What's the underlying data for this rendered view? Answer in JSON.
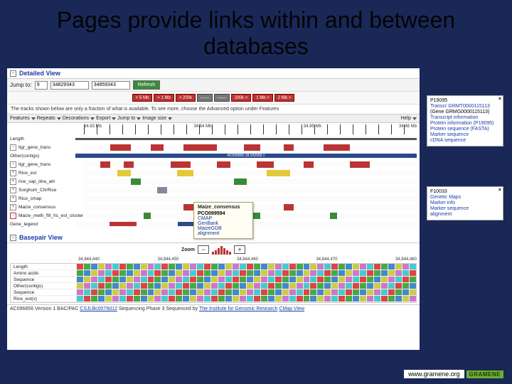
{
  "slide": {
    "title": "Pages provide links within and between databases"
  },
  "detailed": {
    "header": "Detailed View",
    "jump_label": "Jump to:",
    "chrom": "9",
    "from": "34829343",
    "to": "34859343",
    "refresh": "Refresh",
    "zoom": [
      "< 5 Mb",
      "< 1 Mb",
      "< 200k",
      "——",
      "——",
      "200k >",
      "1 Mb >",
      "2 Mb >"
    ],
    "note": "The tracks shown below are only a fraction of what is available. To see more, choose the Advanced option under Features",
    "menu": [
      "Features",
      "Repeats",
      "Decorations",
      "Export",
      "Jump to",
      "Image size"
    ],
    "help": "Help",
    "tracks": [
      "Length",
      "tigr_gene_trans",
      "Other(contigs)",
      "tigr_gene_trans",
      "Rice_est",
      "rice_sap_dna_aln",
      "Sorghum_ChrRice",
      "Rice_cmap",
      "Maize_consensus",
      "Maize_meth_filt_hc_est_cluster",
      "",
      "Gene_legend"
    ]
  },
  "popup": {
    "header": "Maize_consensus",
    "items": [
      "PCO099594",
      "CMAP",
      "GenBank",
      "MaizeGDB",
      "alignment"
    ]
  },
  "basepair": {
    "header": "Basepair View",
    "zoom_label": "Zoom",
    "ruler_ticks": [
      "34,844,440",
      "34,844,450",
      "34,844,460",
      "34,844,470",
      "34,844,480"
    ],
    "rows": [
      "Length",
      "Amino acids",
      "Sequence",
      "Other(contigs)",
      "Sequence",
      "Rice_est(s)"
    ]
  },
  "footer": {
    "text_a": "AC096856 Version 1  BAC/PAC ",
    "link_a": "CSJLBc0079d12",
    "text_b": "  Sequencing Phase 3  Sequenced by ",
    "link_b": "The Institute for Genomic Research",
    "link_c": "CMap View"
  },
  "side1": {
    "id": "P19095",
    "lines": [
      "Transcr GRMT0000115113",
      "(Gene GRMG0000115113)",
      "Transcript information",
      "Protein information (P19095)",
      "Protein sequence (FASTA)",
      "Marker sequence",
      "cDNA sequence"
    ]
  },
  "side2": {
    "id": "F10033",
    "lines": [
      "Genetic Maps",
      "Marker info",
      "Marker sequence",
      "alignment"
    ]
  },
  "url": {
    "text": "www.gramene.org",
    "logo": "GRAMENE"
  },
  "colors": {
    "accent": "#1a3da8",
    "danger": "#b33",
    "ok": "#3a8a3a"
  }
}
